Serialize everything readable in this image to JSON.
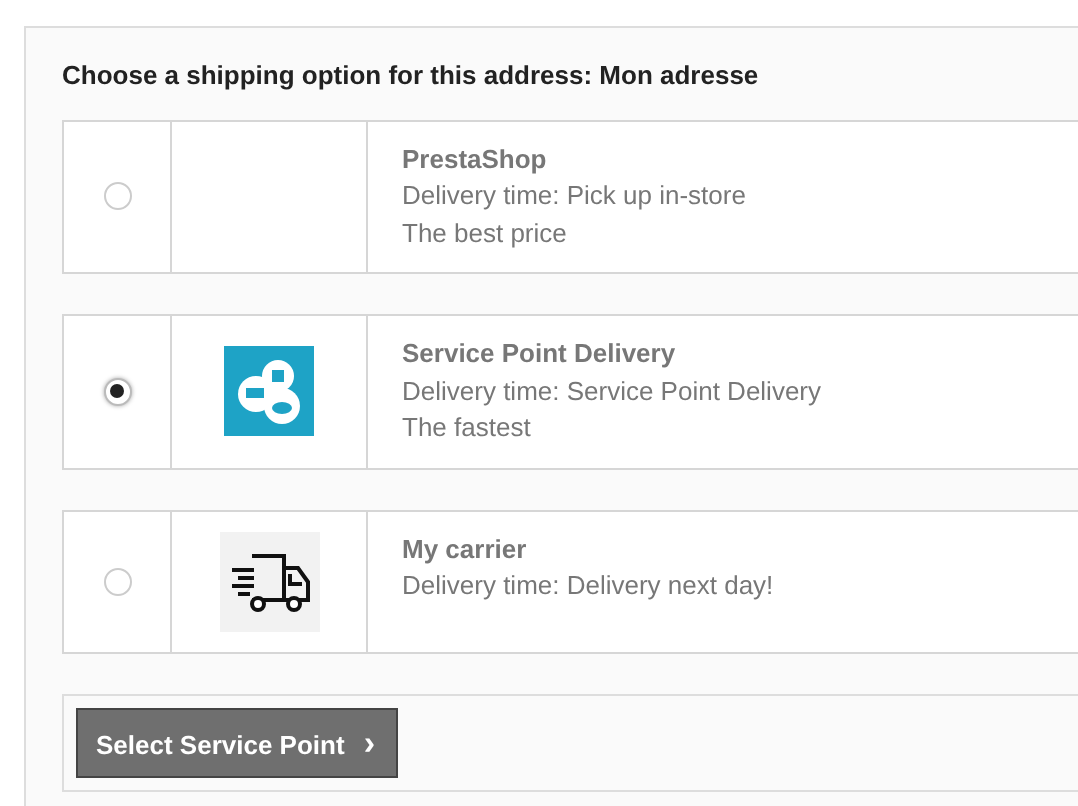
{
  "heading": "Choose a shipping option for this address: Mon adresse",
  "options": [
    {
      "selected": false,
      "kind": "none",
      "name": "PrestaShop",
      "lines": [
        "Delivery time: Pick up in-store",
        "The best price"
      ]
    },
    {
      "selected": true,
      "kind": "cloud",
      "name": "Service Point Delivery",
      "lines": [
        "Delivery time: Service Point Delivery",
        "The fastest"
      ]
    },
    {
      "selected": false,
      "kind": "truck",
      "name": "My carrier",
      "lines": [
        "Delivery time: Delivery next day!"
      ]
    }
  ],
  "button": {
    "label": "Select Service Point",
    "icon": "›"
  }
}
